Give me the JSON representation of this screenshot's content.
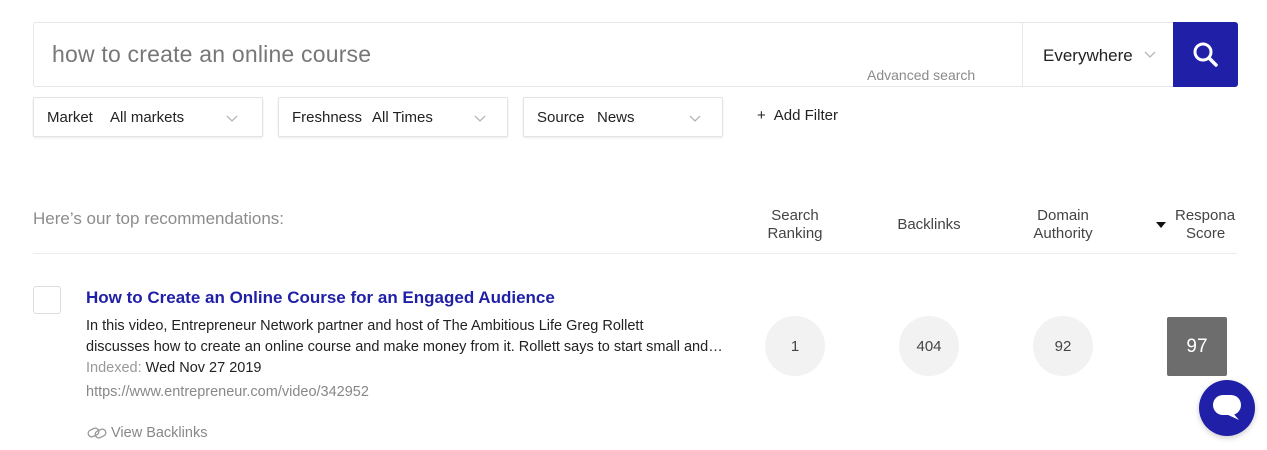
{
  "search": {
    "query": "how to create an online course",
    "advanced_label": "Advanced search",
    "scope_value": "Everywhere"
  },
  "filters": [
    {
      "key": "Market",
      "value": "All markets"
    },
    {
      "key": "Freshness",
      "value": "All Times"
    },
    {
      "key": "Source",
      "value": "News"
    }
  ],
  "add_filter": {
    "plus": "+",
    "label": "Add Filter"
  },
  "results_header": {
    "recommendations": "Here’s our top recommendations:",
    "columns": [
      {
        "line1": "Search",
        "line2": "Ranking"
      },
      {
        "line1": "Backlinks",
        "line2": ""
      },
      {
        "line1": "Domain",
        "line2": "Authority"
      },
      {
        "line1": "Responа",
        "line2": "Score"
      }
    ]
  },
  "result": {
    "title": "How to Create an Online Course for an Engaged Audience",
    "description_line1": "In this video, Entrepreneur Network partner and host of The Ambitious Life Greg Rollett",
    "description_line2": "discusses how to create an online course and make money from it. Rollett says to start small and build up",
    "indexed_label": "Indexed:",
    "indexed_date": "Wed Nov 27 2019",
    "url": "https://www.entrepreneur.com/video/342952",
    "view_backlinks": "View Backlinks",
    "search_ranking": "1",
    "backlinks": "404",
    "domain_authority": "92",
    "response_score": "97"
  },
  "colors": {
    "brand": "#1f1fa8",
    "score_bg": "#6d6d6d",
    "metric_bg": "#f2f2f2"
  },
  "icons": [
    "search-icon",
    "chevron-down-icon",
    "sort-desc-icon",
    "link-icon",
    "chat-icon"
  ]
}
